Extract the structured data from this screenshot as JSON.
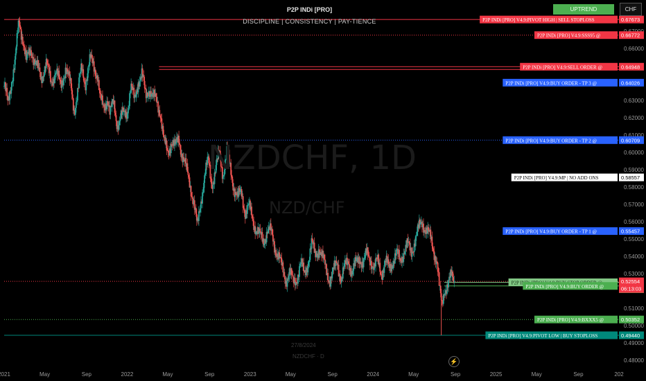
{
  "header": {
    "title": "P2P INDi [PRO]",
    "subtitle": "DISCIPLINE  |  CONSISTENCY  |  PAY-TIENCE",
    "trend_button": "UPTREND",
    "currency_button": "CHF"
  },
  "watermark": {
    "symbol": "NZDCHF, 1D",
    "pair": "NZD/CHF"
  },
  "crosshair": {
    "date": "27/8/2024",
    "symbol": "NZDCHF · D"
  },
  "chart_data": {
    "type": "candlestick",
    "symbol": "NZDCHF",
    "timeframe": "1D",
    "ylim": [
      0.476,
      0.688
    ],
    "y_ticks": [
      "0.48000",
      "0.49000",
      "0.50000",
      "0.51000",
      "0.52000",
      "0.53000",
      "0.54000",
      "0.55000",
      "0.56000",
      "0.57000",
      "0.58000",
      "0.59000",
      "0.60000",
      "0.61000",
      "0.62000",
      "0.63000",
      "0.64000",
      "0.65000",
      "0.66000",
      "0.67000"
    ],
    "x_ticks": [
      {
        "label": "2021",
        "t": 0.0
      },
      {
        "label": "May",
        "t": 0.33
      },
      {
        "label": "Sep",
        "t": 0.67
      },
      {
        "label": "2022",
        "t": 1.0
      },
      {
        "label": "May",
        "t": 1.33
      },
      {
        "label": "Sep",
        "t": 1.67
      },
      {
        "label": "2023",
        "t": 2.0
      },
      {
        "label": "May",
        "t": 2.33
      },
      {
        "label": "Sep",
        "t": 2.67
      },
      {
        "label": "2024",
        "t": 3.0
      },
      {
        "label": "May",
        "t": 3.33
      },
      {
        "label": "Sep",
        "t": 3.67
      },
      {
        "label": "2025",
        "t": 4.0
      },
      {
        "label": "May",
        "t": 4.33
      },
      {
        "label": "Sep",
        "t": 4.67
      },
      {
        "label": "202",
        "t": 5.0
      }
    ],
    "xlim": [
      0.0,
      5.0
    ],
    "price_path": [
      [
        0.0,
        0.638
      ],
      [
        0.03,
        0.628
      ],
      [
        0.06,
        0.642
      ],
      [
        0.09,
        0.652
      ],
      [
        0.12,
        0.676
      ],
      [
        0.15,
        0.667
      ],
      [
        0.18,
        0.652
      ],
      [
        0.22,
        0.66
      ],
      [
        0.26,
        0.65
      ],
      [
        0.3,
        0.643
      ],
      [
        0.34,
        0.652
      ],
      [
        0.38,
        0.64
      ],
      [
        0.42,
        0.648
      ],
      [
        0.46,
        0.637
      ],
      [
        0.5,
        0.65
      ],
      [
        0.54,
        0.638
      ],
      [
        0.57,
        0.625
      ],
      [
        0.6,
        0.636
      ],
      [
        0.63,
        0.648
      ],
      [
        0.66,
        0.641
      ],
      [
        0.7,
        0.653
      ],
      [
        0.73,
        0.65
      ],
      [
        0.76,
        0.645
      ],
      [
        0.78,
        0.63
      ],
      [
        0.81,
        0.625
      ],
      [
        0.84,
        0.633
      ],
      [
        0.86,
        0.622
      ],
      [
        0.89,
        0.628
      ],
      [
        0.92,
        0.617
      ],
      [
        0.95,
        0.62
      ],
      [
        0.98,
        0.622
      ],
      [
        1.0,
        0.624
      ],
      [
        1.03,
        0.638
      ],
      [
        1.06,
        0.629
      ],
      [
        1.09,
        0.642
      ],
      [
        1.12,
        0.645
      ],
      [
        1.15,
        0.632
      ],
      [
        1.18,
        0.638
      ],
      [
        1.21,
        0.631
      ],
      [
        1.24,
        0.63
      ],
      [
        1.27,
        0.624
      ],
      [
        1.3,
        0.605
      ],
      [
        1.33,
        0.6
      ],
      [
        1.36,
        0.607
      ],
      [
        1.39,
        0.602
      ],
      [
        1.42,
        0.609
      ],
      [
        1.45,
        0.598
      ],
      [
        1.48,
        0.59
      ],
      [
        1.51,
        0.583
      ],
      [
        1.54,
        0.572
      ],
      [
        1.57,
        0.556
      ],
      [
        1.6,
        0.573
      ],
      [
        1.63,
        0.586
      ],
      [
        1.66,
        0.595
      ],
      [
        1.69,
        0.582
      ],
      [
        1.72,
        0.59
      ],
      [
        1.75,
        0.599
      ],
      [
        1.78,
        0.588
      ],
      [
        1.81,
        0.6
      ],
      [
        1.84,
        0.59
      ],
      [
        1.87,
        0.58
      ],
      [
        1.9,
        0.573
      ],
      [
        1.93,
        0.577
      ],
      [
        1.96,
        0.566
      ],
      [
        1.99,
        0.568
      ],
      [
        2.02,
        0.562
      ],
      [
        2.05,
        0.556
      ],
      [
        2.08,
        0.551
      ],
      [
        2.11,
        0.549
      ],
      [
        2.14,
        0.556
      ],
      [
        2.17,
        0.553
      ],
      [
        2.2,
        0.546
      ],
      [
        2.23,
        0.541
      ],
      [
        2.26,
        0.532
      ],
      [
        2.29,
        0.527
      ],
      [
        2.32,
        0.531
      ],
      [
        2.35,
        0.524
      ],
      [
        2.38,
        0.528
      ],
      [
        2.41,
        0.536
      ],
      [
        2.44,
        0.529
      ],
      [
        2.47,
        0.537
      ],
      [
        2.5,
        0.547
      ],
      [
        2.53,
        0.54
      ],
      [
        2.56,
        0.546
      ],
      [
        2.59,
        0.538
      ],
      [
        2.62,
        0.532
      ],
      [
        2.65,
        0.527
      ],
      [
        2.68,
        0.531
      ],
      [
        2.71,
        0.537
      ],
      [
        2.74,
        0.527
      ],
      [
        2.77,
        0.533
      ],
      [
        2.8,
        0.538
      ],
      [
        2.83,
        0.531
      ],
      [
        2.86,
        0.535
      ],
      [
        2.89,
        0.54
      ],
      [
        2.92,
        0.536
      ],
      [
        2.95,
        0.541
      ],
      [
        2.98,
        0.539
      ],
      [
        3.01,
        0.533
      ],
      [
        3.04,
        0.537
      ],
      [
        3.07,
        0.531
      ],
      [
        3.1,
        0.536
      ],
      [
        3.13,
        0.533
      ],
      [
        3.16,
        0.538
      ],
      [
        3.19,
        0.541
      ],
      [
        3.22,
        0.537
      ],
      [
        3.25,
        0.544
      ],
      [
        3.28,
        0.546
      ],
      [
        3.31,
        0.542
      ],
      [
        3.34,
        0.55
      ],
      [
        3.37,
        0.555
      ],
      [
        3.4,
        0.56
      ],
      [
        3.43,
        0.556
      ],
      [
        3.46,
        0.551
      ],
      [
        3.49,
        0.545
      ],
      [
        3.52,
        0.537
      ],
      [
        3.54,
        0.52
      ],
      [
        3.56,
        0.511
      ],
      [
        3.58,
        0.522
      ],
      [
        3.61,
        0.524
      ],
      [
        3.64,
        0.528
      ],
      [
        3.66,
        0.526
      ]
    ]
  },
  "levels": [
    {
      "label": "P2P INDi [PRO] V4.9:PIVOT HIGH | SELL STOPLOSS",
      "price": "0.67673",
      "value": 0.67673,
      "bg": "#f23645",
      "fg": "#ffffff",
      "style": "solid",
      "x_start": 0.0
    },
    {
      "label": "P2P INDi [PRO] V4.9:SSS95 @",
      "price": "0.66772",
      "value": 0.66772,
      "bg": "#f23645",
      "fg": "#ffffff",
      "style": "dotted",
      "x_start": 0.0
    },
    {
      "label": "P2P INDi [PRO] V4.9:SELL ORDER @",
      "price": "0.64948",
      "value": 0.64948,
      "bg": "#f23645",
      "fg": "#ffffff",
      "style": "solid",
      "x_start": 1.26
    },
    {
      "label": "P2P INDi [PRO] V4.9:BUY ORDER - TP 3 @",
      "price": "0.64026",
      "value": 0.64026,
      "bg": "#2962ff",
      "fg": "#ffffff",
      "style": "none",
      "x_start": 5.0
    },
    {
      "label": "P2P INDi [PRO] V4.9:BUY ORDER - TP 2 @",
      "price": "0.60709",
      "value": 0.60709,
      "bg": "#2962ff",
      "fg": "#ffffff",
      "style": "dotted",
      "x_start": 0.0
    },
    {
      "label": "P2P INDi [PRO] V4.9:MP | NO ADD ONS",
      "price": "0.58557",
      "value": 0.58557,
      "bg": "#ffffff",
      "fg": "#000000",
      "style": "none",
      "x_start": 5.0
    },
    {
      "label": "P2P INDi [PRO] V4.9:BUY ORDER - TP 1 @",
      "price": "0.55457",
      "value": 0.55457,
      "bg": "#2962ff",
      "fg": "#ffffff",
      "style": "none",
      "x_start": 5.0
    },
    {
      "label": "P2P INDi [PRO] V4.9:BUY STOP ORDER @",
      "price": "0.52500",
      "value": 0.525,
      "bg": "#81c784",
      "fg": "#0a2a0a",
      "style": "solid",
      "x_start": 3.58
    },
    {
      "label": "P2P INDi [PRO] V4.9:BUY ORDER @",
      "price": "0.52289",
      "value": 0.52289,
      "bg": "#4caf50",
      "fg": "#ffffff",
      "style": "solid",
      "x_start": 3.58
    },
    {
      "label": "",
      "price": "0.52100",
      "value": 0.521,
      "bg": "#4caf50",
      "fg": "#ffffff",
      "style": "none",
      "x_start": 5.0
    },
    {
      "label": "P2P INDi [PRO] V4.9:BXXX5 @",
      "price": "0.50352",
      "value": 0.50352,
      "bg": "#4caf50",
      "fg": "#ffffff",
      "style": "dotted",
      "x_start": 0.0
    },
    {
      "label": "P2P INDi [PRO] V4.9:PIVOT LOW | BUY STOPLOSS",
      "price": "0.49440",
      "value": 0.4944,
      "bg": "#00897b",
      "fg": "#ffffff",
      "style": "solid",
      "x_start": 0.0
    }
  ],
  "current_price": {
    "price": "0.52554",
    "countdown": "06:13:03",
    "value": 0.52554,
    "bg": "#f23645"
  },
  "colors": {
    "up": "#26a69a",
    "down": "#ef5350",
    "grid": "#000000",
    "axis_text": "#9a9a9a"
  }
}
